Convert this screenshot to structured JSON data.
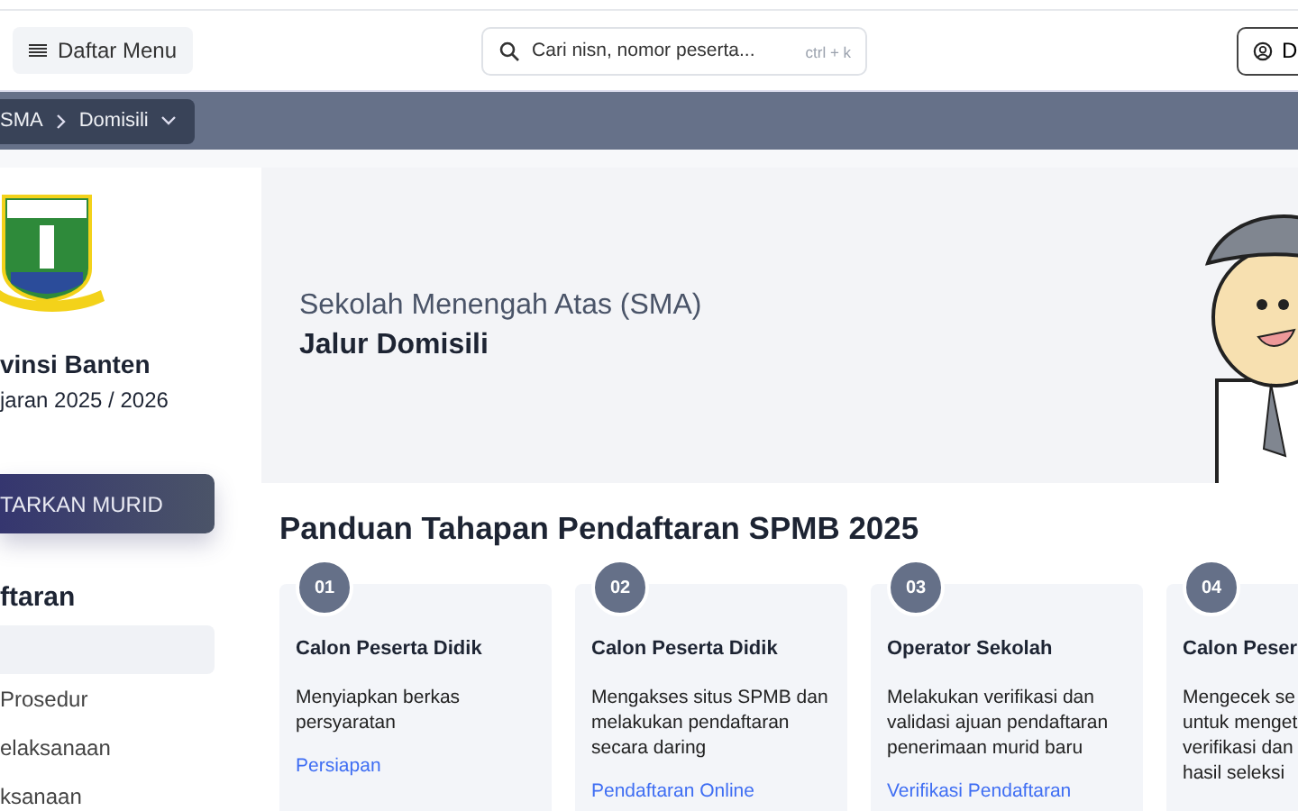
{
  "header": {
    "menu_button": "Daftar Menu",
    "search": {
      "placeholder": "Cari nisn, nomor peserta...",
      "shortcut": "ctrl + k"
    },
    "account_button": "D"
  },
  "breadcrumb": {
    "items": [
      "SMA",
      "Domisili"
    ]
  },
  "sidebar": {
    "province": "vinsi Banten",
    "year": "jaran 2025 / 2026",
    "register_button": "TARKAN MURID",
    "section_title": "ftaran",
    "items": [
      {
        "selected": true
      },
      {
        "label": "Prosedur",
        "selected": false
      },
      {
        "label": "elaksanaan",
        "selected": false
      },
      {
        "label": "ksanaan",
        "selected": false
      }
    ]
  },
  "hero": {
    "subtitle": "Sekolah Menengah Atas (SMA)",
    "title": "Jalur Domisili"
  },
  "guide": {
    "title": "Panduan Tahapan Pendaftaran SPMB 2025",
    "steps": [
      {
        "number": "01",
        "title": "Calon Peserta Didik",
        "description": "Menyiapkan berkas\npersyaratan",
        "link": "Persiapan"
      },
      {
        "number": "02",
        "title": "Calon Peserta Didik",
        "description": "Mengakses situs SPMB dan\nmelakukan pendaftaran\nsecara daring",
        "link": "Pendaftaran Online"
      },
      {
        "number": "03",
        "title": "Operator Sekolah",
        "description": "Melakukan verifikasi dan\nvalidasi ajuan pendaftaran\npenerimaan murid baru",
        "link": "Verifikasi Pendaftaran"
      },
      {
        "number": "04",
        "title": "Calon Peser",
        "description": "Mengecek se\nuntuk menget\nverifikasi dan\nhasil seleksi"
      }
    ]
  }
}
